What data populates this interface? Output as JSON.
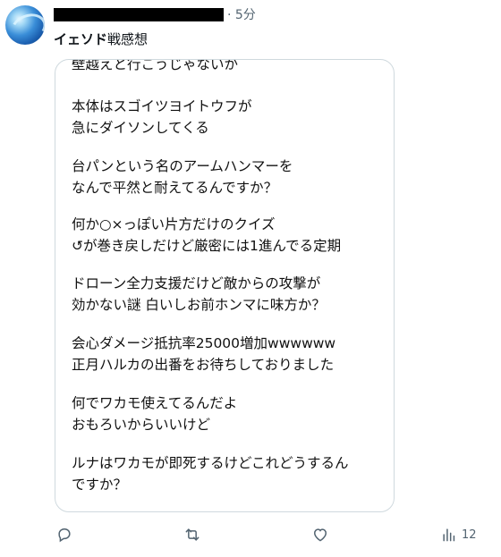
{
  "tweet": {
    "time": "· 5分",
    "text_bold": "イェソド",
    "text_rest": "戦感想"
  },
  "image_lines": [
    "壁越えと行こうじゃないか",
    "本体はスゴイツヨイトウフが",
    "急にダイソンしてくる",
    "台パンという名のアームハンマーを",
    "なんで平然と耐えてるんですか？",
    "何か○×っぽい片方だけのクイズ",
    "↺が巻き戻しだけど厳密には1進んでる定期",
    "ドローン全力支援だけど敵からの攻撃が",
    "効かない謎 白いしお前ホンマに味方か？",
    "会心ダメージ抵抗率25000増加wwwwww",
    "正月ハルカの出番をお待ちしておりました",
    "何でワカモ使えてるんだよ",
    "おもろいからいいけど",
    "ルナはワカモが即死するけどこれどうするん",
    "ですか？"
  ],
  "actions": {
    "reply_icon": "reply-icon",
    "retweet_icon": "retweet-icon",
    "like_icon": "heart-icon",
    "views_icon": "views-icon",
    "views_count": "12"
  }
}
